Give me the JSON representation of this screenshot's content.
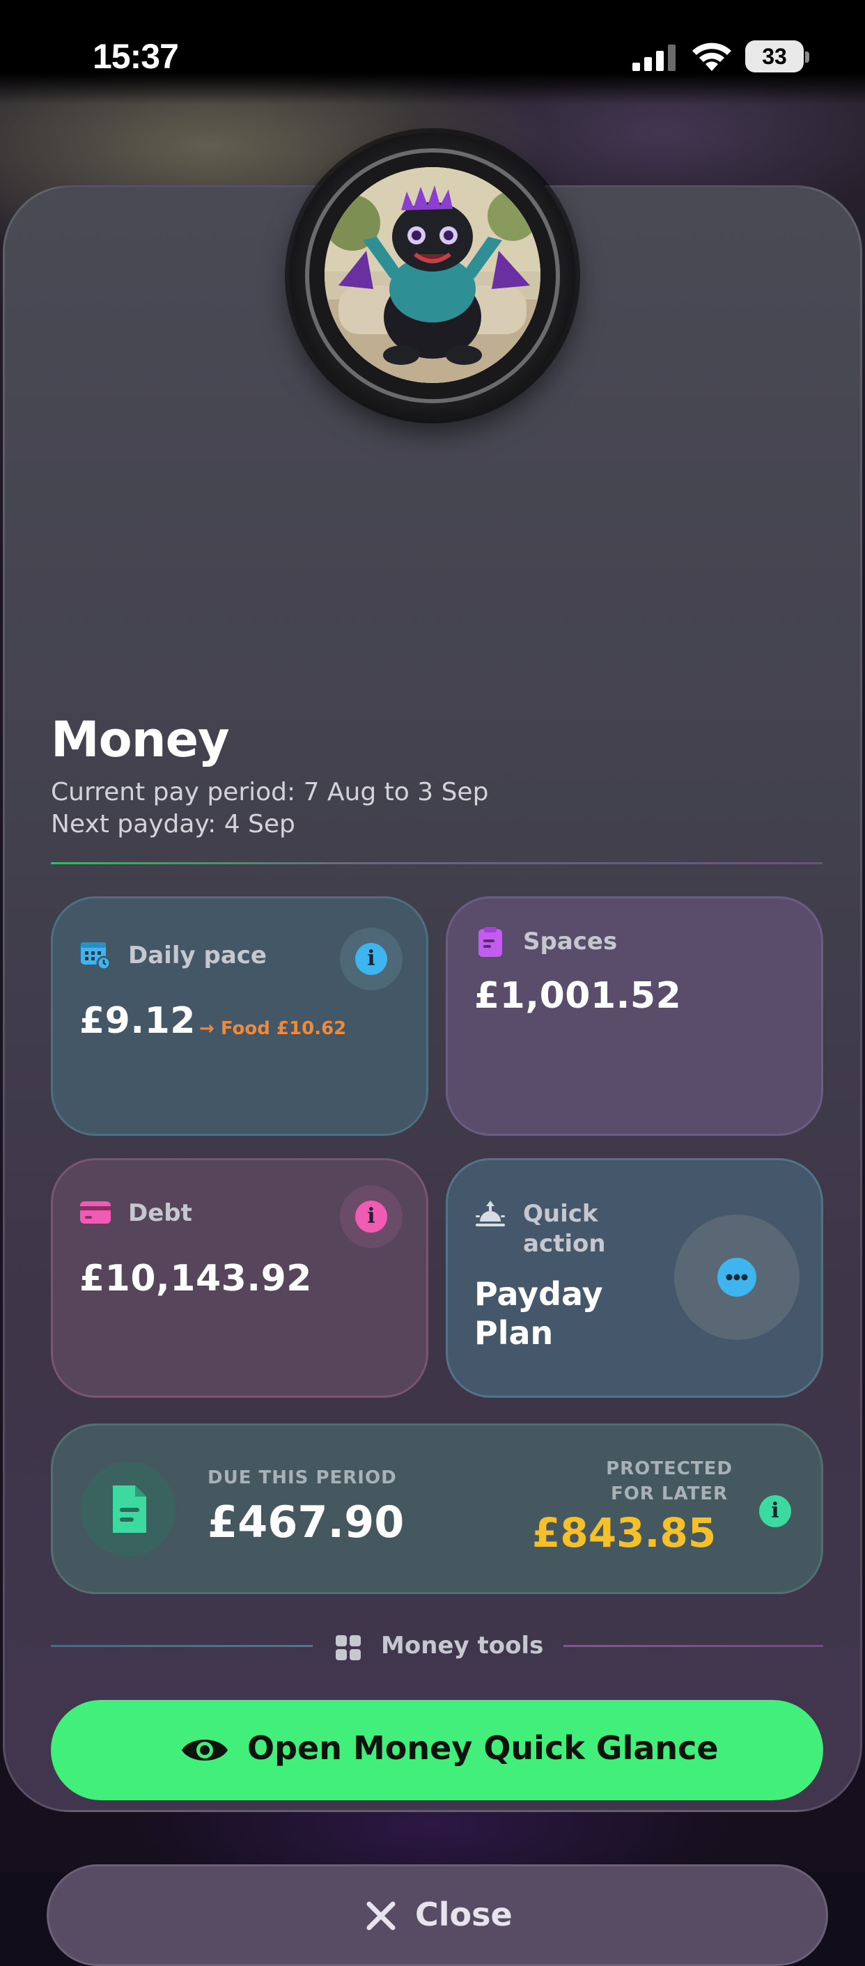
{
  "status_bar": {
    "time": "15:37",
    "battery": "33"
  },
  "header": {
    "title": "Money",
    "pay_period": "Current pay period: 7 Aug to 3 Sep",
    "next_payday": "Next payday: 4 Sep"
  },
  "cards": {
    "daily_pace": {
      "label": "Daily pace",
      "amount": "£9.12",
      "food_hint": "→ Food £10.62",
      "icon": "calendar-icon",
      "accent": "#3fb5f0"
    },
    "spaces": {
      "label": "Spaces",
      "amount": "£1,001.52",
      "icon": "clipboard-icon",
      "accent": "#c35cf0"
    },
    "debt": {
      "label": "Debt",
      "amount": "£10,143.92",
      "icon": "credit-card-icon",
      "accent": "#f05cb4"
    },
    "quick_action": {
      "label_line1": "Quick",
      "label_line2": "action",
      "value": "Payday Plan",
      "icon": "sunrise-icon",
      "accent": "#3fb5f0"
    },
    "due": {
      "due_label": "DUE THIS PERIOD",
      "due_amount": "£467.90",
      "protected_label": "PROTECTED FOR LATER",
      "protected_amount": "£843.85",
      "icon": "document-icon",
      "accent": "#3cd9a0",
      "protected_color": "#f5c02a"
    }
  },
  "tools": {
    "label": "Money tools",
    "icon": "grid-icon"
  },
  "actions": {
    "glance_label": "Open Money Quick Glance",
    "glance_color": "#42ef7a",
    "close_label": "Close"
  }
}
